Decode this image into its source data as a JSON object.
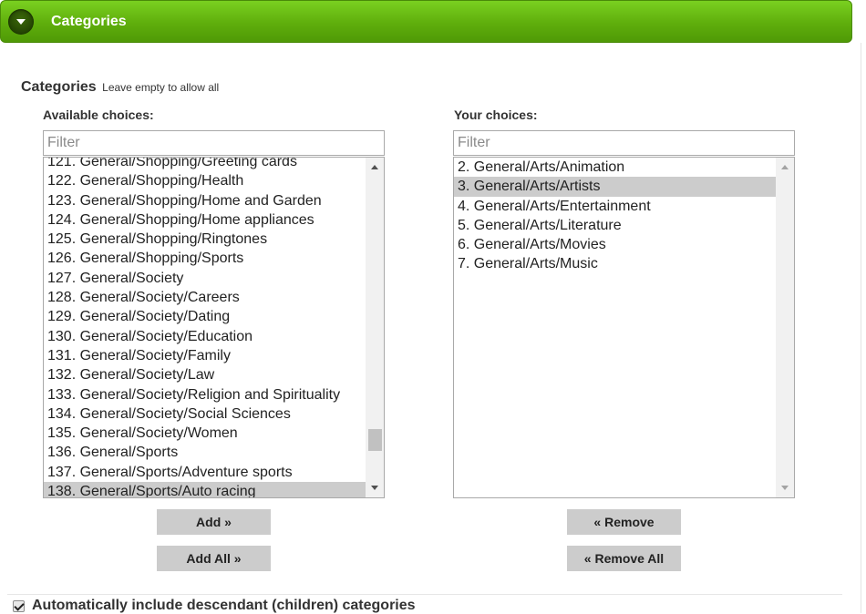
{
  "header": {
    "title": "Categories"
  },
  "field": {
    "label": "Categories",
    "help": "Leave empty to allow all"
  },
  "available": {
    "title": "Available choices:",
    "filter_placeholder": "Filter",
    "items": [
      "121. General/Shopping/Greeting cards",
      "122. General/Shopping/Health",
      "123. General/Shopping/Home and Garden",
      "124. General/Shopping/Home appliances",
      "125. General/Shopping/Ringtones",
      "126. General/Shopping/Sports",
      "127. General/Society",
      "128. General/Society/Careers",
      "129. General/Society/Dating",
      "130. General/Society/Education",
      "131. General/Society/Family",
      "132. General/Society/Law",
      "133. General/Society/Religion and Spirituality",
      "134. General/Society/Social Sciences",
      "135. General/Society/Women",
      "136. General/Sports",
      "137. General/Sports/Adventure sports",
      "138. General/Sports/Auto racing"
    ],
    "selected": "138. General/Sports/Auto racing"
  },
  "chosen": {
    "title": "Your choices:",
    "filter_placeholder": "Filter",
    "items": [
      "2. General/Arts/Animation",
      "3. General/Arts/Artists",
      "4. General/Arts/Entertainment",
      "5. General/Arts/Literature",
      "6. General/Arts/Movies",
      "7. General/Arts/Music"
    ],
    "selected": "3. General/Arts/Artists"
  },
  "buttons": {
    "add": "Add »",
    "add_all": "Add All »",
    "remove": "« Remove",
    "remove_all": "« Remove All"
  },
  "auto_include": {
    "label": "Automatically include descendant (children) categories",
    "checked": true
  },
  "colors": {
    "header_green": "#5fae0c",
    "selection_gray": "#cccccc",
    "button_gray": "#cccccc"
  }
}
